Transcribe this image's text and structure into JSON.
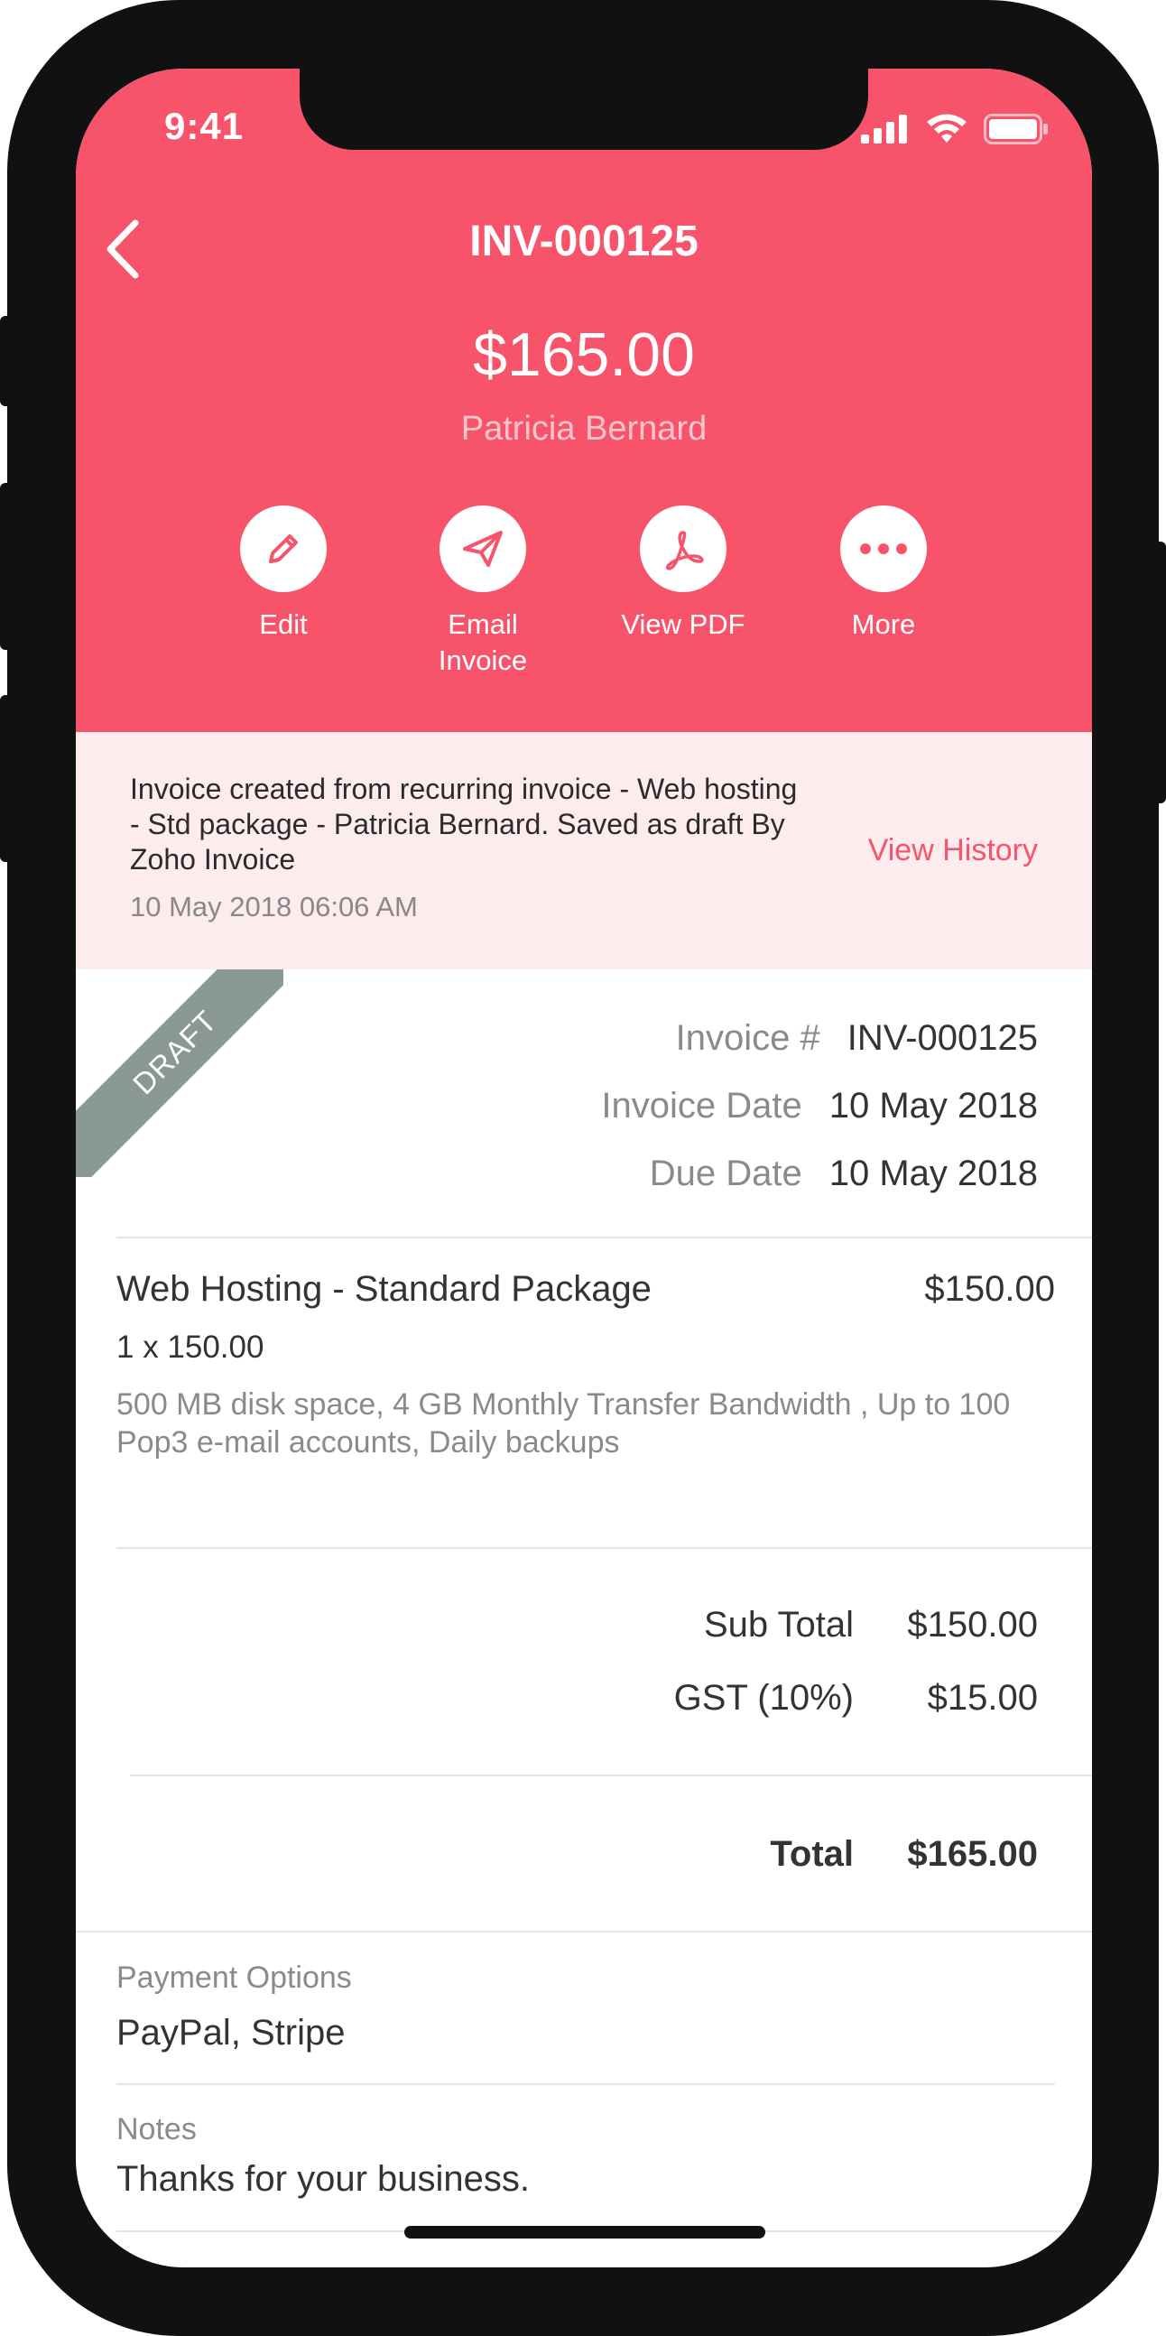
{
  "status_bar": {
    "time": "9:41",
    "icons": [
      "signal-icon",
      "wifi-icon",
      "battery-icon"
    ]
  },
  "header": {
    "title": "INV-000125",
    "amount": "$165.00",
    "customer": "Patricia Bernard",
    "actions": [
      {
        "label": "Edit",
        "icon": "pencil-icon"
      },
      {
        "label": "Email\nInvoice",
        "icon": "paper-plane-icon"
      },
      {
        "label": "View PDF",
        "icon": "pdf-icon"
      },
      {
        "label": "More",
        "icon": "more-dots-icon"
      }
    ]
  },
  "history": {
    "message": "Invoice created from recurring invoice - Web hosting - Std package - Patricia Bernard. Saved as draft By Zoho Invoice",
    "timestamp": "10 May 2018 06:06 AM",
    "link": "View History"
  },
  "details": {
    "status_ribbon": "DRAFT",
    "invoice_number_label": "Invoice #",
    "invoice_number": "INV-000125",
    "invoice_date_label": "Invoice Date",
    "invoice_date": "10 May 2018",
    "due_date_label": "Due Date",
    "due_date": "10 May 2018"
  },
  "line_item": {
    "name": "Web Hosting - Standard Package",
    "amount": "$150.00",
    "quantity": "1 x 150.00",
    "description": "500 MB disk space, 4 GB Monthly Transfer Bandwidth , Up to 100 Pop3 e-mail accounts, Daily backups"
  },
  "totals": {
    "sub_total_label": "Sub Total",
    "sub_total": "$150.00",
    "tax_label": "GST (10%)",
    "tax": "$15.00",
    "total_label": "Total",
    "total": "$165.00"
  },
  "payment": {
    "label": "Payment Options",
    "value": "PayPal, Stripe"
  },
  "notes": {
    "label": "Notes",
    "value": "Thanks for your business."
  },
  "colors": {
    "accent": "#f7536a",
    "banner_bg": "#fdecee",
    "ribbon": "#8a9895"
  }
}
